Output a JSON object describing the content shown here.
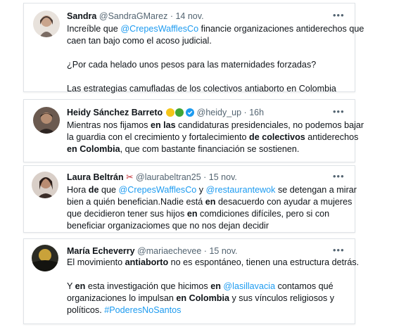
{
  "tweets": [
    {
      "name": "Sandra",
      "handle": "@SandraGMarez",
      "sep": "·",
      "time": "14 nov.",
      "more": "•••",
      "l1a": "Increíble que ",
      "l1m": "@CrepesWafflesCo",
      "l1b": " financie organizaciones antiderechos que",
      "l2": "caen tan bajo como el acoso judicial.",
      "l3": "¿Por cada helado unos pesos para las maternidades forzadas?",
      "l4": "Las estrategias camufladas de los colectivos antiaborto en Colombia"
    },
    {
      "name": "Heidy Sánchez Barreto",
      "handle": "@heidy_up",
      "sep": "·",
      "time": "16h",
      "more": "•••",
      "emoji_colors": [
        "#f5c518",
        "#3fa535"
      ],
      "verified_color": "#1d9bf0",
      "l1a": "Mientras nos fijamos ",
      "l1b": "en las",
      "l1c": " candidaturas presidenciales, no podemos bajar",
      "l2a": "la guardia con el crecimiento y fortalecimiento ",
      "l2b": "de colectivos",
      "l2c": " antiderechos",
      "l3a": "en Colombia",
      "l3b": ", que com bastante financiación se sostienen."
    },
    {
      "name": "Laura Beltrán",
      "scissors": "✂",
      "handle": "@laurabeltran25",
      "sep": "·",
      "time": "15 nov.",
      "more": "•••",
      "l1a": "Hora ",
      "l1b": "de",
      "l1c": " que ",
      "l1m1": "@CrepesWafflesCo",
      "l1d": " y ",
      "l1m2": "@restaurantewok",
      "l1e": " se detengan a mirar",
      "l2a": "bien a quién benefician.Nadie está ",
      "l2b": "en",
      "l2c": " desacuerdo con ayudar a mujeres",
      "l3a": "que decidieron tener sus hijos ",
      "l3b": "en",
      "l3c": " comdiciones difíciles, pero si con",
      "l4": "beneficiar organizaciomes que no nos dejan decidir"
    },
    {
      "name": "María Echeverry",
      "handle": "@mariaechevee",
      "sep": "·",
      "time": "15 nov.",
      "more": "•••",
      "l1a": "El movimiento ",
      "l1b": "antiaborto",
      "l1c": " no es espontáneo, tienen una estructura detrás.",
      "l2a": "Y ",
      "l2b": "en",
      "l2c": " esta investigación que hicimos ",
      "l2d": "en",
      "l2e": " ",
      "l2m": "@lasillavacia",
      "l2f": " contamos qué",
      "l3a": "organizaciones lo impulsan ",
      "l3b": "en Colombia",
      "l3c": " y sus vínculos religiosos y",
      "l4a": "políticos. ",
      "l4h": "#PoderesNoSantos"
    }
  ]
}
